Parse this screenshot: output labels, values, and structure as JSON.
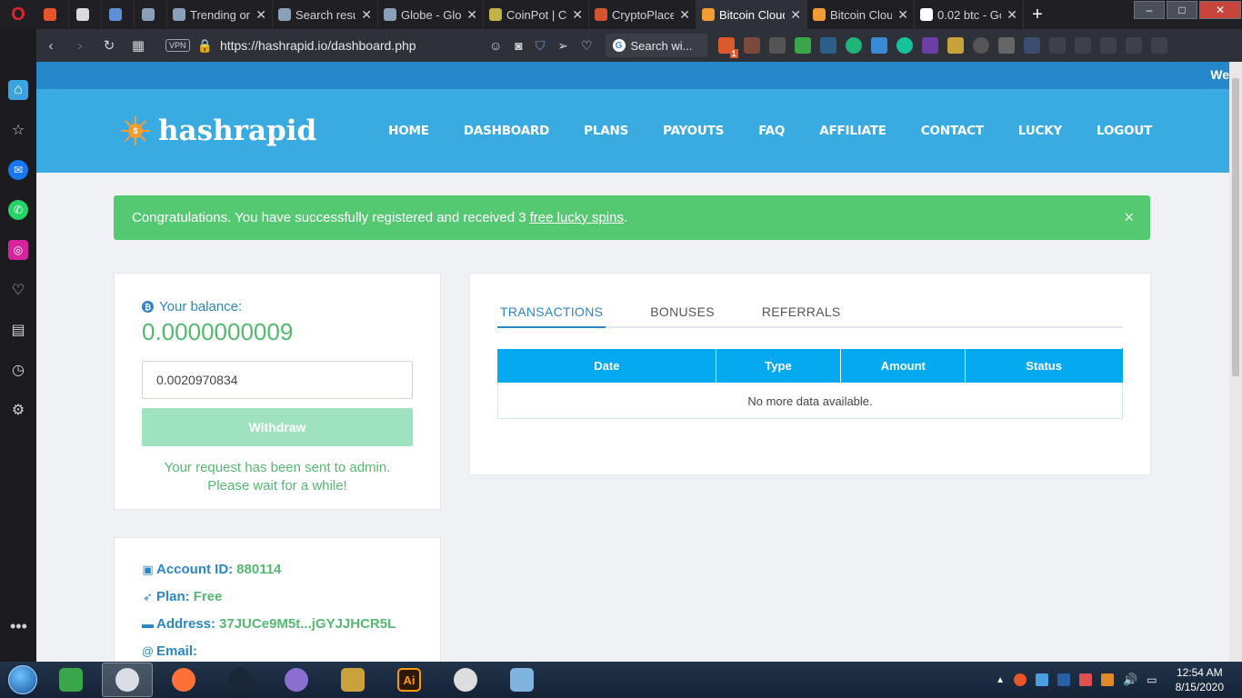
{
  "browser": {
    "tabs": [
      {
        "label": "",
        "fav": "#e8552b"
      },
      {
        "label": "",
        "fav": "#d9dbe0"
      },
      {
        "label": "",
        "fav": "#5b8fd6"
      },
      {
        "label": "",
        "fav": "#8aa0b8"
      },
      {
        "label": "Trending on",
        "fav": "#8aa0b8"
      },
      {
        "label": "Search resul",
        "fav": "#8aa0b8"
      },
      {
        "label": "Globe - Glob",
        "fav": "#8aa0b8"
      },
      {
        "label": "CoinPot | Cry",
        "fav": "#c3b24a"
      },
      {
        "label": "CryptoPlace",
        "fav": "#d6542d"
      },
      {
        "label": "Bitcoin Cloud",
        "fav": "#f39c34"
      },
      {
        "label": "Bitcoin Cloud",
        "fav": "#f39c34"
      },
      {
        "label": "0.02 btc - Go",
        "fav": "#ffffff"
      }
    ],
    "url": "https://hashrapid.io/dashboard.php",
    "vpn_label": "VPN",
    "search_placeholder": "Search wi...",
    "extension_badge": "1"
  },
  "site": {
    "ticker_text": "We",
    "logo_text": "hashrapid",
    "logo_coin": "$",
    "nav": [
      "HOME",
      "DASHBOARD",
      "PLANS",
      "PAYOUTS",
      "FAQ",
      "AFFILIATE",
      "CONTACT",
      "LUCKY",
      "LOGOUT"
    ]
  },
  "alert": {
    "text": "Congratulations. You have successfully registered and received 3",
    "link": "free lucky spins",
    "suffix": ".",
    "close": "×"
  },
  "balance": {
    "label": "Your balance:",
    "value": "0.0000000009",
    "input_value": "0.0020970834",
    "withdraw_label": "Withdraw",
    "note": "Your request has been sent to admin. Please wait for a while!"
  },
  "account": {
    "id_label": "Account ID:",
    "id_value": "880114",
    "plan_label": "Plan:",
    "plan_value": "Free",
    "address_label": "Address:",
    "address_value": "37JUCe9M5t...jGYJJHCR5L",
    "email_label": "Email:"
  },
  "transactions": {
    "tabs": [
      "TRANSACTIONS",
      "BONUSES",
      "REFERRALS"
    ],
    "columns": [
      "Date",
      "Type",
      "Amount",
      "Status"
    ],
    "empty_text": "No more data available."
  },
  "taskbar": {
    "time": "12:54 AM",
    "date": "8/15/2020",
    "apps": [
      {
        "name": "clover-app",
        "color": "#3aa64a"
      },
      {
        "name": "opera-app",
        "color": "#d9dde4"
      },
      {
        "name": "firefox-app",
        "color": "#ff7139"
      },
      {
        "name": "steam-app",
        "color": "#1b2838"
      },
      {
        "name": "media-app",
        "color": "#8a6fd1"
      },
      {
        "name": "game-app",
        "color": "#c9a23a"
      },
      {
        "name": "illustrator-app",
        "color": "#ff9a00"
      },
      {
        "name": "obs-app",
        "color": "#dddddd"
      },
      {
        "name": "notepad-app",
        "color": "#7fb3e0"
      }
    ],
    "ai_label": "Ai"
  }
}
